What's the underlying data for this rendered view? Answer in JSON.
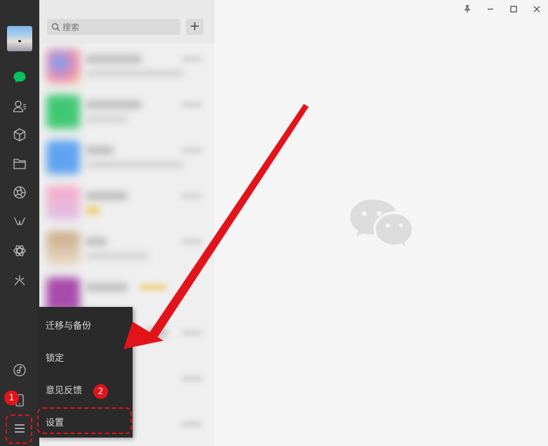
{
  "search": {
    "placeholder": "搜索"
  },
  "add_button_label": "+",
  "sidebar_icons": [
    "chat-icon",
    "contacts-icon",
    "cube-icon",
    "folder-icon",
    "moments-icon",
    "channels-icon",
    "mini-programs-icon",
    "look-icon",
    "music-icon",
    "phone-icon",
    "menu-icon"
  ],
  "popup_menu": {
    "items": [
      {
        "label": "迁移与备份"
      },
      {
        "label": "锁定"
      },
      {
        "label": "意见反馈"
      },
      {
        "label": "设置"
      }
    ]
  },
  "annotations": {
    "badge1": "1",
    "badge2": "2",
    "accent": "#e1141c"
  },
  "window_controls": [
    "pin-icon",
    "minimize-icon",
    "maximize-icon",
    "close-icon"
  ]
}
